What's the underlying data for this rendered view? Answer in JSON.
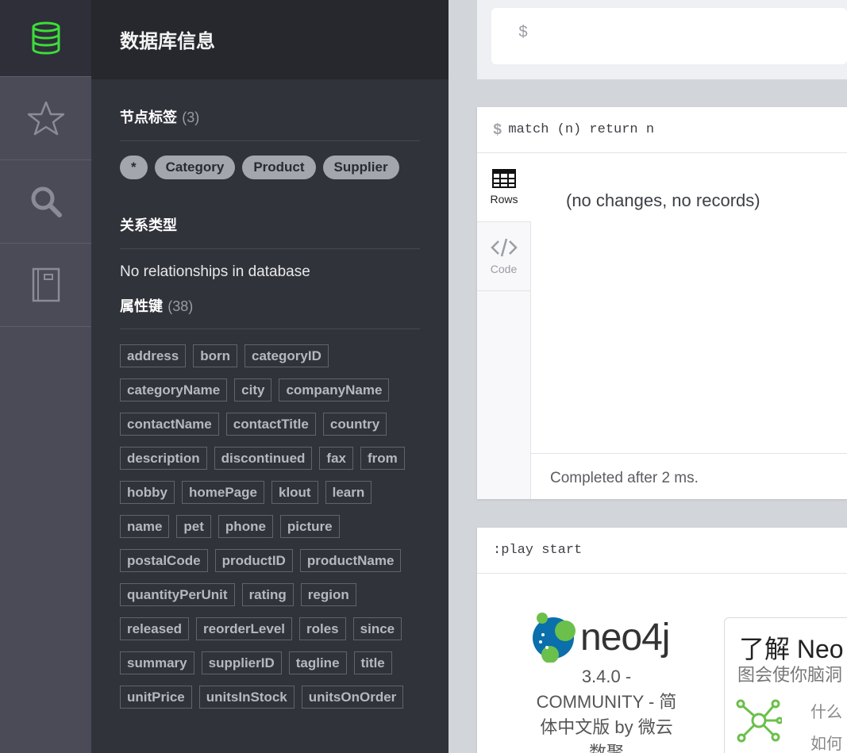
{
  "rail": {
    "items": [
      {
        "name": "database-icon",
        "active": true
      },
      {
        "name": "star-icon"
      },
      {
        "name": "search-icon"
      },
      {
        "name": "book-icon"
      }
    ]
  },
  "drawer": {
    "title": "数据库信息",
    "node_labels": {
      "title": "节点标签",
      "count": "(3)",
      "items": [
        "*",
        "Category",
        "Product",
        "Supplier"
      ]
    },
    "rel_types": {
      "title": "关系类型",
      "empty": "No relationships in database"
    },
    "property_keys": {
      "title": "属性键",
      "count": "(38)",
      "items": [
        "address",
        "born",
        "categoryID",
        "categoryName",
        "city",
        "companyName",
        "contactName",
        "contactTitle",
        "country",
        "description",
        "discontinued",
        "fax",
        "from",
        "hobby",
        "homePage",
        "klout",
        "learn",
        "name",
        "pet",
        "phone",
        "picture",
        "postalCode",
        "productID",
        "productName",
        "quantityPerUnit",
        "rating",
        "region",
        "released",
        "reorderLevel",
        "roles",
        "since",
        "summary",
        "supplierID",
        "tagline",
        "title",
        "unitPrice",
        "unitsInStock",
        "unitsOnOrder"
      ]
    }
  },
  "editor": {
    "prompt": "$"
  },
  "result_frame": {
    "dollar": "$",
    "query": "match (n) return n",
    "tabs": [
      {
        "label": "Rows",
        "icon": "table-icon"
      },
      {
        "label": "Code",
        "icon": "code-icon"
      }
    ],
    "message": "(no changes, no records)",
    "footer": "Completed after 2 ms."
  },
  "play_frame": {
    "command": ":play start",
    "logo_text": "neo4j",
    "version_line1": "3.4.0 -",
    "version_line2": "COMMUNITY - 简",
    "version_line3": "体中文版 by 微云",
    "version_line4": "数聚",
    "card_title": "了解 Neo",
    "card_subtitle": "图会使你脑洞",
    "card_line1": "什么",
    "card_line2": "如何"
  }
}
